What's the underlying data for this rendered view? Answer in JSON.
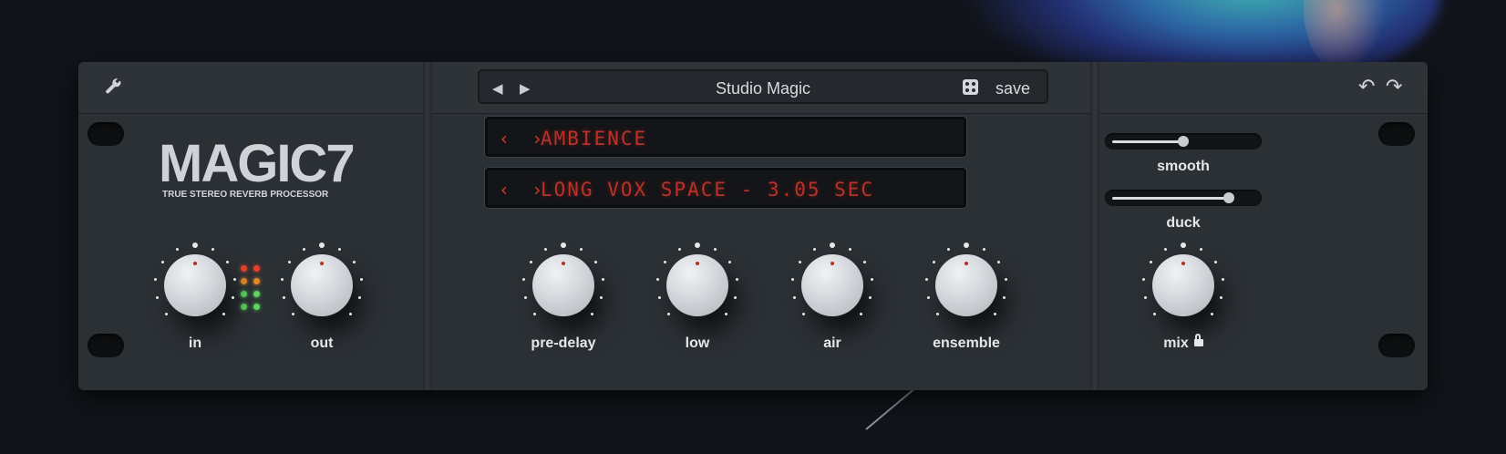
{
  "header": {
    "preset_name": "Studio Magic",
    "save_label": "save",
    "prev_icon": "◀",
    "next_icon": "▶",
    "undo_icon": "↶",
    "redo_icon": "↷"
  },
  "brand": {
    "logo": "MAGIC7",
    "tagline": "TRUE STEREO REVERB PROCESSOR"
  },
  "displays": [
    {
      "arrows": "‹ ›",
      "text": "AMBIENCE"
    },
    {
      "arrows": "‹ ›",
      "text": "LONG VOX SPACE - 3.05 SEC"
    }
  ],
  "knobs": {
    "in": "in",
    "out": "out",
    "pre_delay": "pre-delay",
    "low": "low",
    "air": "air",
    "ensemble": "ensemble",
    "mix": "mix"
  },
  "sliders": {
    "smooth": {
      "label": "smooth",
      "value": 0.5
    },
    "duck": {
      "label": "duck",
      "value": 0.85
    }
  },
  "meter": {
    "rows": [
      [
        "#e0432a",
        "#e0432a"
      ],
      [
        "#e08a2a",
        "#e08a2a"
      ],
      [
        "#5fd65f",
        "#5fd65f"
      ],
      [
        "#5fd65f",
        "#5fd65f"
      ]
    ]
  },
  "colors": {
    "lcd_text": "#b8322a",
    "panel": "#2b3035"
  }
}
